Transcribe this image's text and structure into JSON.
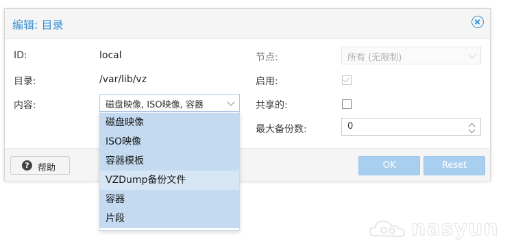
{
  "dialog": {
    "title": "编辑: 目录"
  },
  "form": {
    "id_label": "ID:",
    "id_value": "local",
    "directory_label": "目录:",
    "directory_value": "/var/lib/vz",
    "content_label": "内容:",
    "content_value": "磁盘映像, ISO映像, 容器",
    "node_label": "节点:",
    "node_value": "所有 (无限制)",
    "enable_label": "启用:",
    "enable_checked": true,
    "shared_label": "共享的:",
    "shared_checked": false,
    "max_backups_label": "最大备份数:",
    "max_backups_value": "0"
  },
  "content_options": [
    {
      "label": "磁盘映像",
      "selected": true
    },
    {
      "label": "ISO映像",
      "selected": true
    },
    {
      "label": "容器模板",
      "selected": true
    },
    {
      "label": "VZDump备份文件",
      "selected": false,
      "hover": true
    },
    {
      "label": "容器",
      "selected": true
    },
    {
      "label": "片段",
      "selected": true
    }
  ],
  "footer": {
    "help_label": "帮助",
    "ok_label": "OK",
    "reset_label": "Reset"
  },
  "watermark": {
    "text": "nasyun"
  },
  "colors": {
    "accent": "#3892d4",
    "selected_option": "#c3daf0",
    "hover_option": "#d7e6f5",
    "primary_button": "#a9cff0"
  }
}
